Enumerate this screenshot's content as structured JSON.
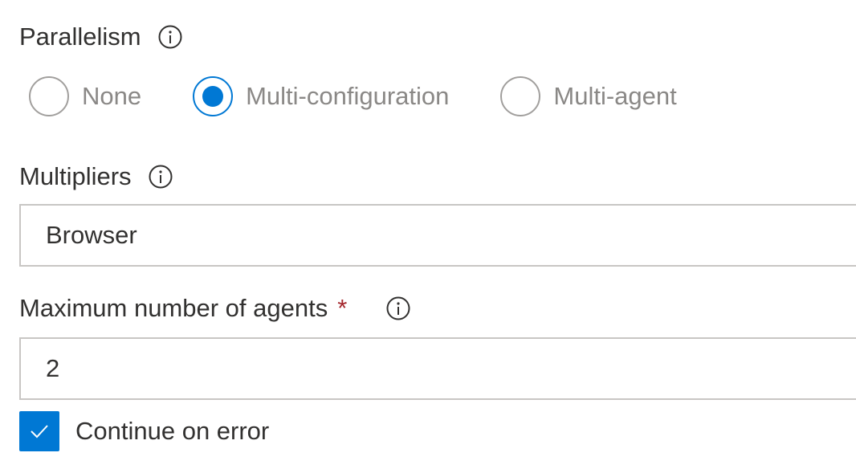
{
  "parallelism": {
    "label": "Parallelism",
    "info_icon": "info-icon",
    "options": [
      {
        "label": "None",
        "selected": false
      },
      {
        "label": "Multi-configuration",
        "selected": true
      },
      {
        "label": "Multi-agent",
        "selected": false
      }
    ]
  },
  "multipliers": {
    "label": "Multipliers",
    "info_icon": "info-icon",
    "value": "Browser"
  },
  "max_agents": {
    "label": "Maximum number of agents",
    "required_mark": "*",
    "info_icon": "info-icon",
    "value": "2"
  },
  "continue_on_error": {
    "label": "Continue on error",
    "checked": true,
    "icon": "checkmark-icon"
  },
  "colors": {
    "accent": "#0078d4",
    "required": "#a4262c",
    "border": "#c8c6c4",
    "text": "#323130",
    "muted_text": "#8a8886"
  }
}
